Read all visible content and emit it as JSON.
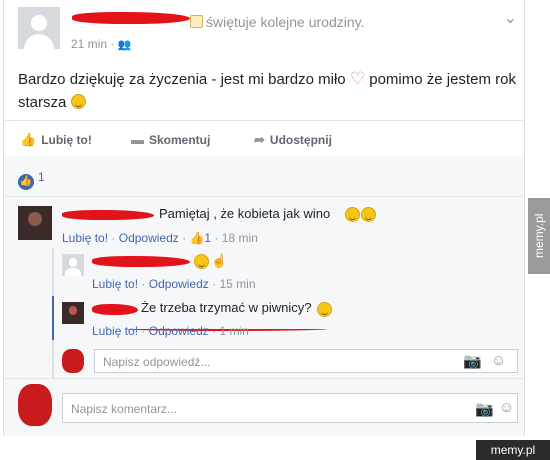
{
  "post": {
    "header_text": "świętuje kolejne urodziny.",
    "time": "21 min",
    "body_text_1": "Bardzo dziękuję za życzenia - jest mi bardzo miło",
    "body_text_2": "pomimo że jestem rok",
    "body_text_3": "starsza",
    "options_icon": "chevron-down-icon"
  },
  "actions": {
    "like": "Lubię to!",
    "comment": "Skomentuj",
    "share": "Udostępnij"
  },
  "reactions": {
    "count": "1"
  },
  "comments": [
    {
      "text": "Pamiętaj , że kobieta jak wino",
      "like": "Lubię to!",
      "reply": "Odpowiedz",
      "likes": "1",
      "time": "18 min"
    },
    {
      "like": "Lubię to!",
      "reply": "Odpowiedz",
      "time": "15 min"
    },
    {
      "text": "Że trzeba trzymać w piwnicy?",
      "like": "Lubię to!",
      "reply": "Odpowiedz",
      "time": "1 min"
    }
  ],
  "reply_input": {
    "placeholder": "Napisz odpowiedź..."
  },
  "comment_input": {
    "placeholder": "Napisz komentarz..."
  },
  "watermark": {
    "side": "memy.pl",
    "bottom": "memy.pl"
  },
  "colors": {
    "accent": "#4267b2",
    "redaction": "#e2131b"
  }
}
